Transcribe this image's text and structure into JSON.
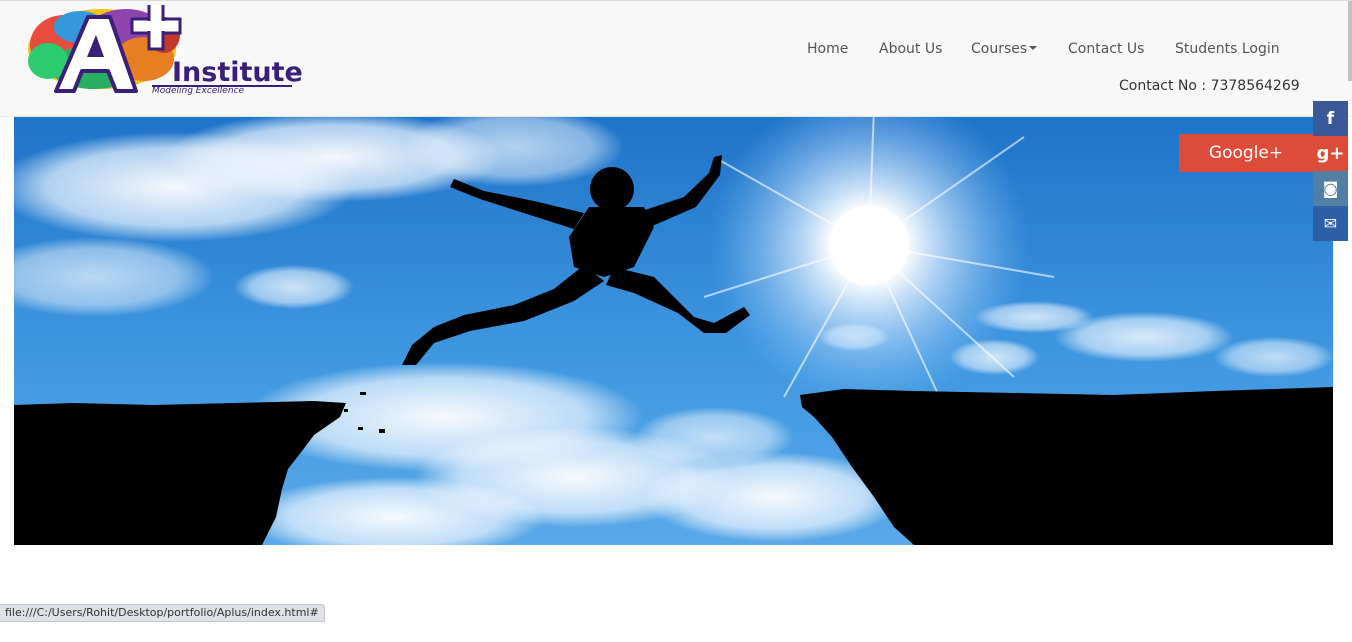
{
  "logo": {
    "mark": "A+",
    "name": "Institute",
    "tagline": "Modeling Excellence"
  },
  "nav": {
    "items": [
      {
        "label": "Home"
      },
      {
        "label": "About Us"
      },
      {
        "label": "Courses"
      },
      {
        "label": "Contact Us"
      },
      {
        "label": "Students Login"
      }
    ],
    "contact": "Contact No : 7378564269"
  },
  "social": {
    "facebook_glyph": "f",
    "gplus_glyph": "g+",
    "instagram_glyph": "◙",
    "mail_glyph": "✉",
    "gplus_tab_label": "Google+"
  },
  "hero": {
    "image": "silhouette-jumping-between-cliffs-sky-sun"
  },
  "status": {
    "url": "file:///C:/Users/Rohit/Desktop/portfolio/Aplus/index.html#"
  },
  "colors": {
    "header_bg": "#f8f8f8",
    "facebook": "#3b5998",
    "gplus": "#dd4b39",
    "instagram": "#517fa4",
    "mail": "#2e5fa6"
  }
}
